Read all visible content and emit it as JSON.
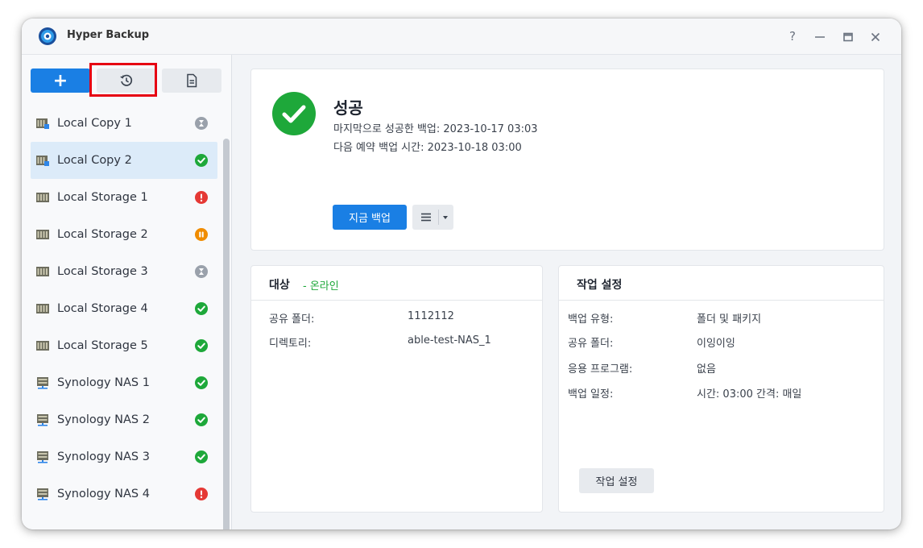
{
  "app": {
    "title": "Hyper Backup",
    "icon": "hyper-backup-logo"
  },
  "window_controls": {
    "help": "?",
    "icons": [
      "minimize-icon",
      "maximize-icon",
      "close-icon"
    ]
  },
  "toolbar": {
    "add_label": "+",
    "history_icon": "history-icon",
    "log_icon": "document-icon"
  },
  "tasks": [
    {
      "name": "Local Copy 1",
      "type_icon": "local-copy-icon",
      "status": "waiting"
    },
    {
      "name": "Local Copy 2",
      "type_icon": "local-copy-icon",
      "status": "success",
      "selected": true
    },
    {
      "name": "Local Storage 1",
      "type_icon": "local-storage-icon",
      "status": "error"
    },
    {
      "name": "Local Storage 2",
      "type_icon": "local-storage-icon",
      "status": "paused"
    },
    {
      "name": "Local Storage 3",
      "type_icon": "local-storage-icon",
      "status": "waiting"
    },
    {
      "name": "Local Storage 4",
      "type_icon": "local-storage-icon",
      "status": "success"
    },
    {
      "name": "Local Storage 5",
      "type_icon": "local-storage-icon",
      "status": "success"
    },
    {
      "name": "Synology NAS 1",
      "type_icon": "nas-icon",
      "status": "success"
    },
    {
      "name": "Synology NAS 2",
      "type_icon": "nas-icon",
      "status": "success"
    },
    {
      "name": "Synology NAS 3",
      "type_icon": "nas-icon",
      "status": "success"
    },
    {
      "name": "Synology NAS 4",
      "type_icon": "nas-icon",
      "status": "error"
    }
  ],
  "status": {
    "title": "성공",
    "last_success": "마지막으로 성공한 백업: 2023-10-17 03:03",
    "next_scheduled": "다음 예약 백업 시간: 2023-10-18 03:00",
    "backup_now_label": "지금 백업"
  },
  "target": {
    "title": "대상",
    "status_text": "- 온라인",
    "rows": [
      {
        "label": "공유 폴더:",
        "value": "1112112"
      },
      {
        "label": "디렉토리:",
        "value": "able-test-NAS_1"
      }
    ]
  },
  "task_settings": {
    "title": "작업 설정",
    "rows": [
      {
        "label": "백업 유형:",
        "value": "폴더 및 패키지"
      },
      {
        "label": "공유 폴더:",
        "value": "이잉이잉"
      },
      {
        "label": "응용 프로그램:",
        "value": "없음"
      },
      {
        "label": "백업 일정:",
        "value": "시간: 03:00 간격: 매일"
      }
    ],
    "button_label": "작업 설정"
  },
  "colors": {
    "accent": "#1a7fe4",
    "success": "#1ea83a",
    "error": "#e53935",
    "paused": "#f08c00",
    "waiting": "#9aa1ab",
    "highlight": "#e60012"
  }
}
